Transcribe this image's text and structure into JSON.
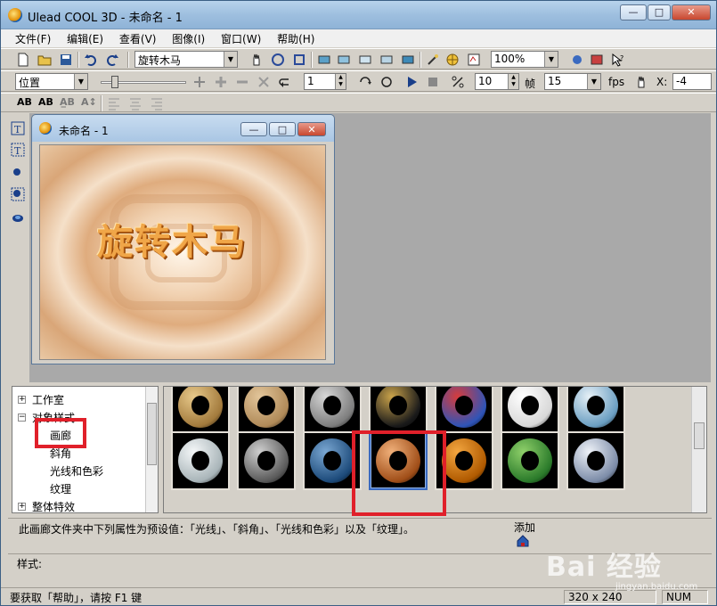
{
  "window": {
    "title": "Ulead COOL 3D - 未命名 - 1",
    "min": "—",
    "max": "□",
    "close": "✕"
  },
  "menu": [
    "文件(F)",
    "编辑(E)",
    "查看(V)",
    "图像(I)",
    "窗口(W)",
    "帮助(H)"
  ],
  "toolbar1": {
    "text_combo": "旋转木马",
    "zoom_combo": "100%"
  },
  "toolbar2": {
    "mode_combo": "位置",
    "frame_spin": "1",
    "frames_spin": "10",
    "frames_label": "帧",
    "fps_combo": "15",
    "fps_label": "fps",
    "x_label": "X:",
    "x_value": "-4"
  },
  "toolbar3": {
    "ab1": "AB",
    "ab2": "AB",
    "ab3": "A̲B",
    "ab4": "A↕"
  },
  "document": {
    "title": "未命名 - 1",
    "canvas_text": "旋转木马"
  },
  "tree": {
    "items": [
      "工作室",
      "对象样式",
      "画廊",
      "斜角",
      "光线和色彩",
      "纹理",
      "整体特效"
    ],
    "expanders": [
      "+",
      "−",
      "+"
    ]
  },
  "gallery": {
    "rows": [
      [
        {
          "name": "gold-studded-donut",
          "c1": "#a27a3c",
          "c2": "#e8c98a"
        },
        {
          "name": "rivet-gold-donut",
          "c1": "#b08a58",
          "c2": "#e2c59a"
        },
        {
          "name": "silver-bolt-donut",
          "c1": "#7d7d7d",
          "c2": "#d6d6d6"
        },
        {
          "name": "black-gold-donut",
          "c1": "#1a1a1a",
          "c2": "#c9a24a"
        },
        {
          "name": "colorful-donut",
          "c1": "#2e54b8",
          "c2": "#d63c3c"
        },
        {
          "name": "white-donut",
          "c1": "#d8d8d8",
          "c2": "#ffffff"
        },
        {
          "name": "pearl-blue-donut",
          "c1": "#6a9ec2",
          "c2": "#e6f0f6"
        }
      ],
      [
        {
          "name": "pearl-white-donut",
          "c1": "#a8b4b8",
          "c2": "#f4f7f8"
        },
        {
          "name": "chrome-donut",
          "c1": "#5a5a5a",
          "c2": "#cfcfcf"
        },
        {
          "name": "blue-ice-donut",
          "c1": "#1c4a7a",
          "c2": "#7aa7d2"
        },
        {
          "name": "copper-donut",
          "c1": "#a04e18",
          "c2": "#f0b07a"
        },
        {
          "name": "amber-donut",
          "c1": "#b05a00",
          "c2": "#f3a640"
        },
        {
          "name": "green-donut",
          "c1": "#2a7a2a",
          "c2": "#8fd06a"
        },
        {
          "name": "marble-donut",
          "c1": "#7c8ca8",
          "c2": "#eef2f8"
        }
      ]
    ],
    "selected_row": 1,
    "selected_col": 3
  },
  "info": {
    "text": "此画廊文件夹中下列属性为预设值：「光线」、「斜角」、「光线和色彩」以及「纹理」。",
    "add_label": "添加"
  },
  "style": {
    "label": "样式:"
  },
  "status": {
    "help": "要获取「帮助」，请按 F1 键",
    "size": "320 x 240",
    "num": "NUM"
  },
  "watermark": {
    "text": "Bai 经验",
    "url": "jingyan.baidu.com"
  },
  "colors": {
    "accent_red": "#e0202a",
    "titlebar": "#a9c6e4"
  }
}
